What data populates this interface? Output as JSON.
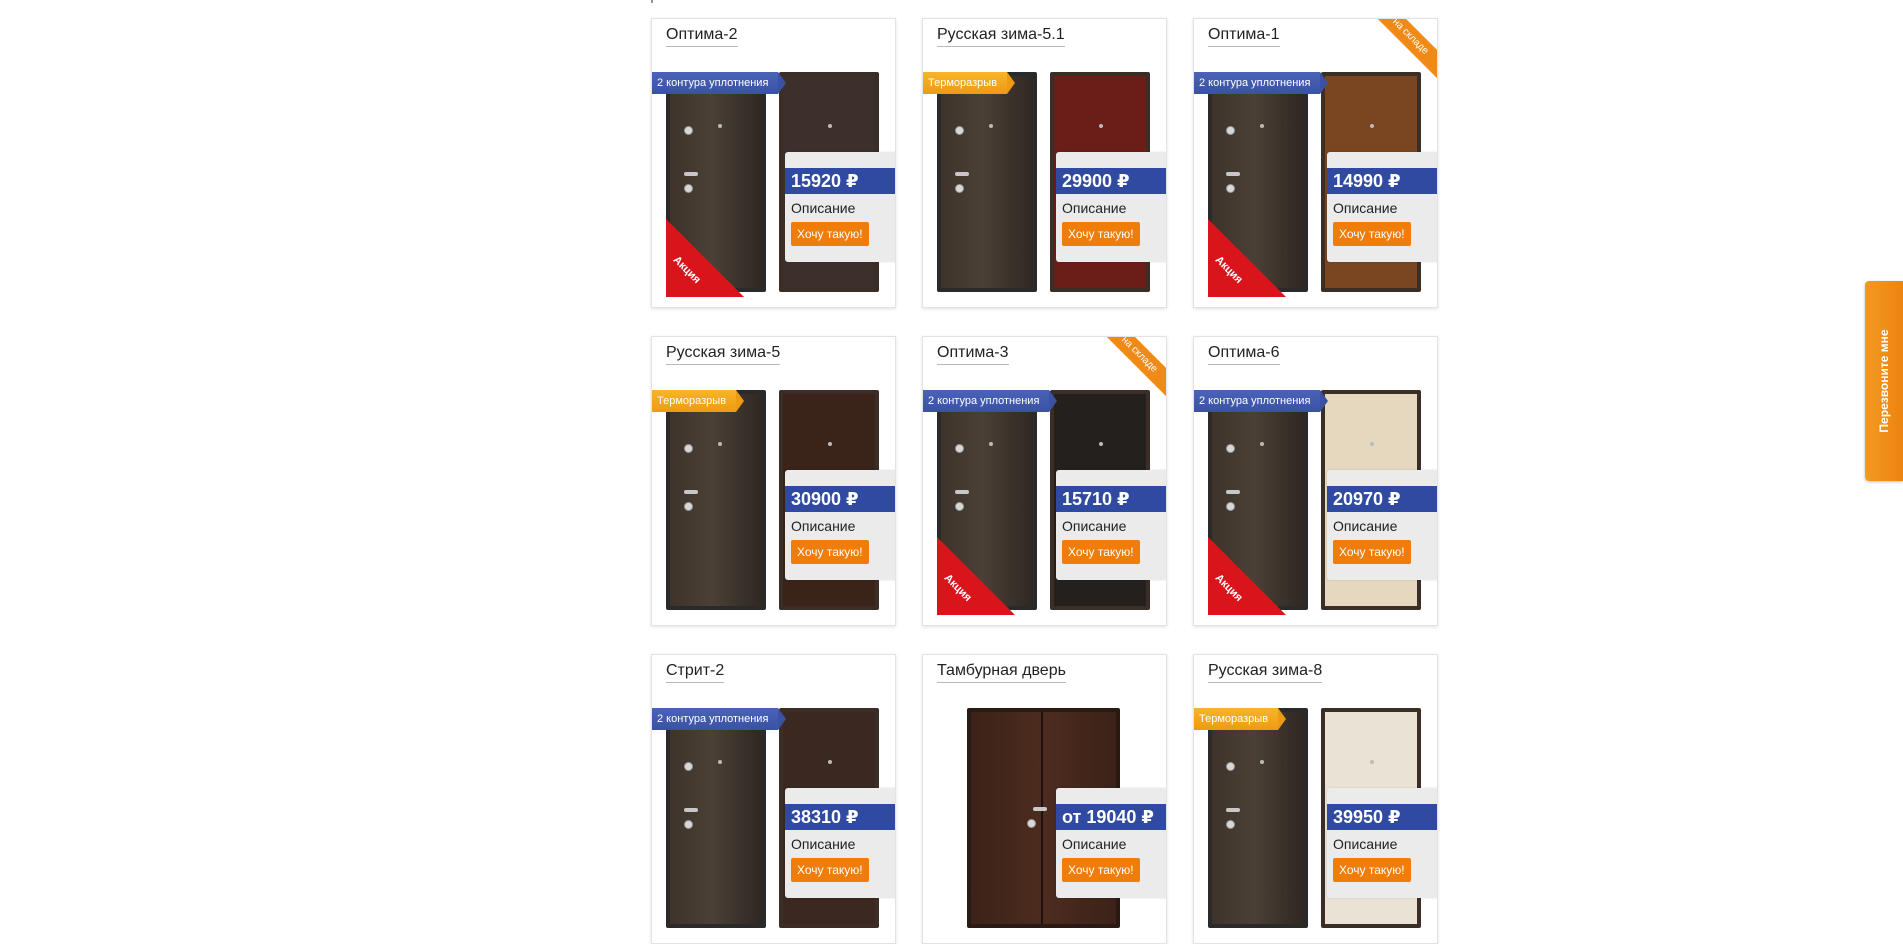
{
  "products": [
    {
      "name": "Оптима-2",
      "price": "15920 ₽",
      "desc": "Описание",
      "buy": "Хочу такую!",
      "badge": "2 контура уплотнения",
      "badge_color": "blue",
      "sale": "Акция",
      "stock": null,
      "inner_color": "#3d302a"
    },
    {
      "name": "Русская зима-5.1",
      "price": "29900 ₽",
      "desc": "Описание",
      "buy": "Хочу такую!",
      "badge": "Терморазрыв",
      "badge_color": "yellow",
      "sale": null,
      "stock": null,
      "inner_color": "#6b1e18"
    },
    {
      "name": "Оптима-1",
      "price": "14990 ₽",
      "desc": "Описание",
      "buy": "Хочу такую!",
      "badge": "2 контура уплотнения",
      "badge_color": "blue",
      "sale": "Акция",
      "stock": "на складе",
      "inner_color": "#7a4521"
    },
    {
      "name": "Русская зима-5",
      "price": "30900 ₽",
      "desc": "Описание",
      "buy": "Хочу такую!",
      "badge": "Терморазрыв",
      "badge_color": "yellow",
      "sale": null,
      "stock": null,
      "inner_color": "#3a2318"
    },
    {
      "name": "Оптима-3",
      "price": "15710 ₽",
      "desc": "Описание",
      "buy": "Хочу такую!",
      "badge": "2 контура уплотнения",
      "badge_color": "blue",
      "sale": "Акция",
      "stock": "на складе",
      "inner_color": "#24201e"
    },
    {
      "name": "Оптима-6",
      "price": "20970 ₽",
      "desc": "Описание",
      "buy": "Хочу такую!",
      "badge": "2 контура уплотнения",
      "badge_color": "blue",
      "sale": "Акция",
      "stock": null,
      "inner_color": "#e6d7bf"
    },
    {
      "name": "Стрит-2",
      "price": "38310 ₽",
      "desc": "Описание",
      "buy": "Хочу такую!",
      "badge": "2 контура уплотнения",
      "badge_color": "blue",
      "sale": null,
      "stock": null,
      "inner_color": "#3b2820"
    },
    {
      "name": "Тамбурная дверь",
      "price": "от 19040 ₽",
      "desc": "Описание",
      "buy": "Хочу такую!",
      "badge": null,
      "badge_color": null,
      "sale": null,
      "stock": null,
      "inner_color": null
    },
    {
      "name": "Русская зима-8",
      "price": "39950 ₽",
      "desc": "Описание",
      "buy": "Хочу такую!",
      "badge": "Терморазрыв",
      "badge_color": "yellow",
      "sale": null,
      "stock": null,
      "inner_color": "#eae2d4"
    }
  ],
  "callback": {
    "label": "Перезвоните мне"
  },
  "colors": {
    "accent": "#f07d0a",
    "price_bg": "#2f4aa0",
    "sale": "#d9141b",
    "badge_blue": "#3a52a4",
    "badge_yellow": "#ee9a12"
  }
}
